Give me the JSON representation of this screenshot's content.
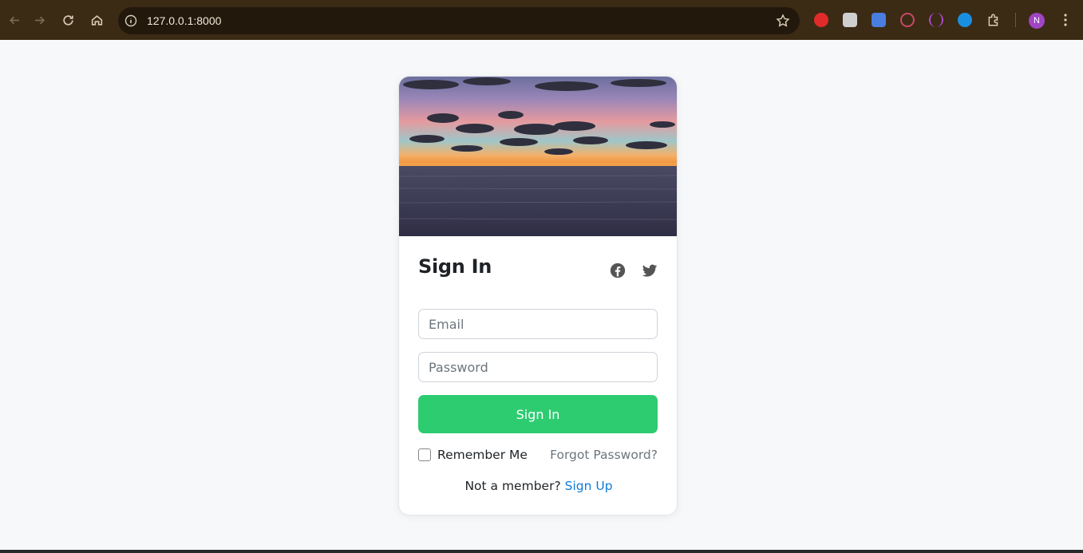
{
  "browser": {
    "url": "127.0.0.1:8000",
    "avatar_initial": "N",
    "extension_colors": [
      "#e02b2b",
      "#cfcfcf",
      "#4a7de0",
      "#c9486a",
      "#b04ad8",
      "#1a8fe0"
    ]
  },
  "card": {
    "title": "Sign In",
    "email_placeholder": "Email",
    "password_placeholder": "Password",
    "submit_label": "Sign In",
    "remember_label": "Remember Me",
    "forgot_label": "Forgot Password?",
    "signup_prompt": "Not a member?",
    "signup_link": "Sign Up",
    "social_icons": [
      "facebook-icon",
      "twitter-icon"
    ]
  },
  "colors": {
    "primary_button": "#2ecc71",
    "link": "#0d7bd8",
    "page_background": "#f7f8fa"
  }
}
